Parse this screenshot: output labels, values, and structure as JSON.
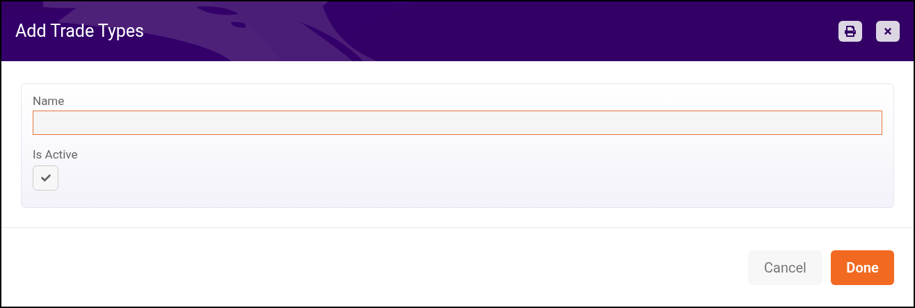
{
  "dialog": {
    "title": "Add Trade Types"
  },
  "header_buttons": [
    {
      "kind": "print"
    },
    {
      "kind": "close"
    }
  ],
  "form": {
    "name_field": {
      "label": "Name",
      "focused": true
    },
    "is_active": {
      "label": "Is Active",
      "checked": true
    }
  },
  "buttons": [
    {
      "label": "Cancel",
      "kind": "secondary"
    },
    {
      "label": "Done",
      "kind": "primary"
    }
  ]
}
